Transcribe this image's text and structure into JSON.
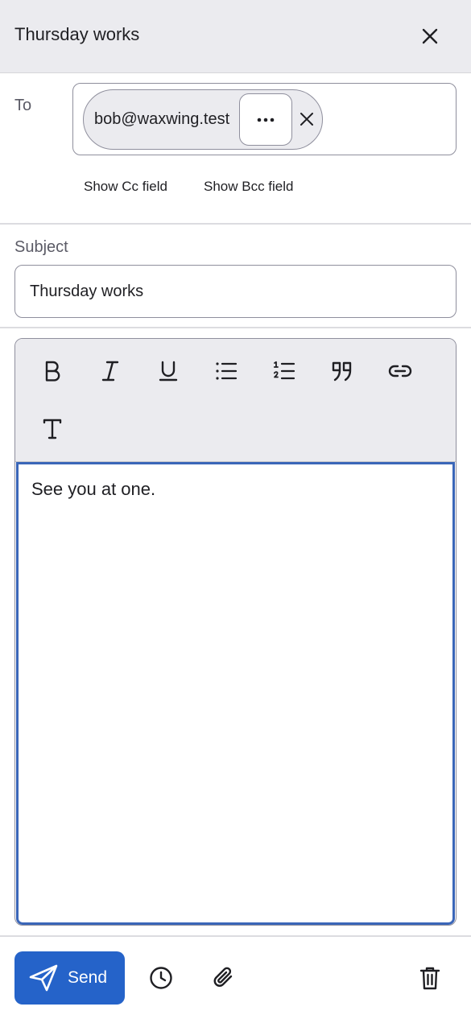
{
  "header": {
    "title": "Thursday works",
    "close_icon": "close-icon"
  },
  "to": {
    "label": "To",
    "recipients": [
      {
        "email": "bob@waxwing.test"
      }
    ],
    "more_icon": "more-horizontal-icon",
    "remove_icon": "close-icon"
  },
  "links": {
    "show_cc": "Show Cc field",
    "show_bcc": "Show Bcc field"
  },
  "subject": {
    "label": "Subject",
    "value": "Thursday works"
  },
  "toolbar": {
    "items": [
      "bold-icon",
      "italic-icon",
      "underline-icon",
      "bullet-list-icon",
      "numbered-list-icon",
      "quote-icon",
      "link-icon",
      "text-style-icon"
    ]
  },
  "body": {
    "text": "See you at one."
  },
  "footer": {
    "send_label": "Send",
    "icons": [
      "send-icon",
      "schedule-clock-icon",
      "attachment-icon",
      "trash-icon"
    ]
  },
  "colors": {
    "accent": "#2563c9",
    "header_bg": "#ebebef",
    "focus_border": "#3a66b8"
  }
}
